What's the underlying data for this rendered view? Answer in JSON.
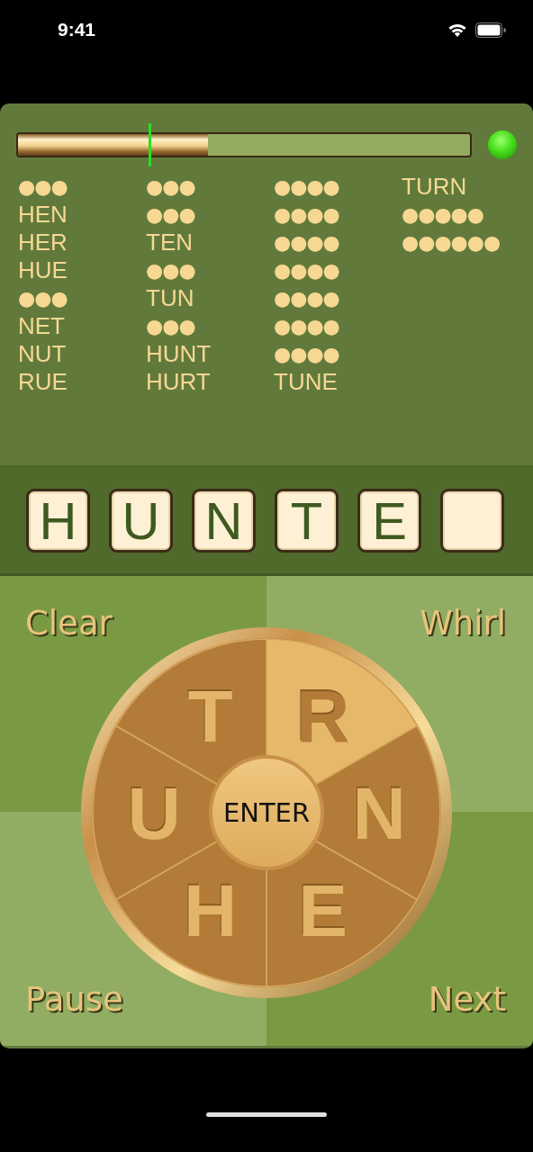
{
  "status_bar": {
    "time": "9:41"
  },
  "timer": {
    "level": 0.42,
    "marker": {
      "level": 0.29
    },
    "light": {
      "on": true
    }
  },
  "word_columns": [
    {
      "words": [
        {
          "found": false,
          "text": "●●●"
        },
        {
          "found": true,
          "text": "HEN"
        },
        {
          "found": true,
          "text": "HER"
        },
        {
          "found": true,
          "text": "HUE"
        },
        {
          "found": false,
          "text": "●●●"
        },
        {
          "found": true,
          "text": "NET"
        },
        {
          "found": true,
          "text": "NUT"
        },
        {
          "found": true,
          "text": "RUE"
        }
      ]
    },
    {
      "words": [
        {
          "found": false,
          "text": "●●●"
        },
        {
          "found": false,
          "text": "●●●"
        },
        {
          "found": true,
          "text": "TEN"
        },
        {
          "found": false,
          "text": "●●●"
        },
        {
          "found": true,
          "text": "TUN"
        },
        {
          "found": false,
          "text": "●●●"
        },
        {
          "found": true,
          "text": "HUNT"
        },
        {
          "found": true,
          "text": "HURT"
        }
      ]
    },
    {
      "words": [
        {
          "found": false,
          "text": "●●●●"
        },
        {
          "found": false,
          "text": "●●●●"
        },
        {
          "found": false,
          "text": "●●●●"
        },
        {
          "found": false,
          "text": "●●●●"
        },
        {
          "found": false,
          "text": "●●●●"
        },
        {
          "found": false,
          "text": "●●●●"
        },
        {
          "found": false,
          "text": "●●●●"
        },
        {
          "found": true,
          "text": "TUNE"
        }
      ]
    },
    {
      "words": [
        {
          "found": true,
          "text": "TURN"
        },
        {
          "found": false,
          "text": "●●●●●"
        },
        {
          "found": false,
          "text": "●●●●●●"
        }
      ]
    }
  ],
  "tiles": [
    {
      "kind": "letter",
      "letter": "H"
    },
    {
      "kind": "letter",
      "letter": "U"
    },
    {
      "kind": "letter",
      "letter": "N"
    },
    {
      "kind": "letter",
      "letter": "T"
    },
    {
      "kind": "letter",
      "letter": "E"
    },
    {
      "kind": "empty"
    }
  ],
  "corner_buttons": [
    {
      "label": "Clear"
    },
    {
      "label": "Whirl"
    },
    {
      "label": "Pause"
    },
    {
      "label": "Next"
    }
  ],
  "wheel": {
    "segments": [
      {
        "letter": "R",
        "selected": true
      },
      {
        "letter": "N",
        "selected": false
      },
      {
        "letter": "E",
        "selected": false
      },
      {
        "letter": "H",
        "selected": false
      },
      {
        "letter": "U",
        "selected": false
      },
      {
        "letter": "T",
        "selected": false
      }
    ],
    "center": "ENTER"
  }
}
